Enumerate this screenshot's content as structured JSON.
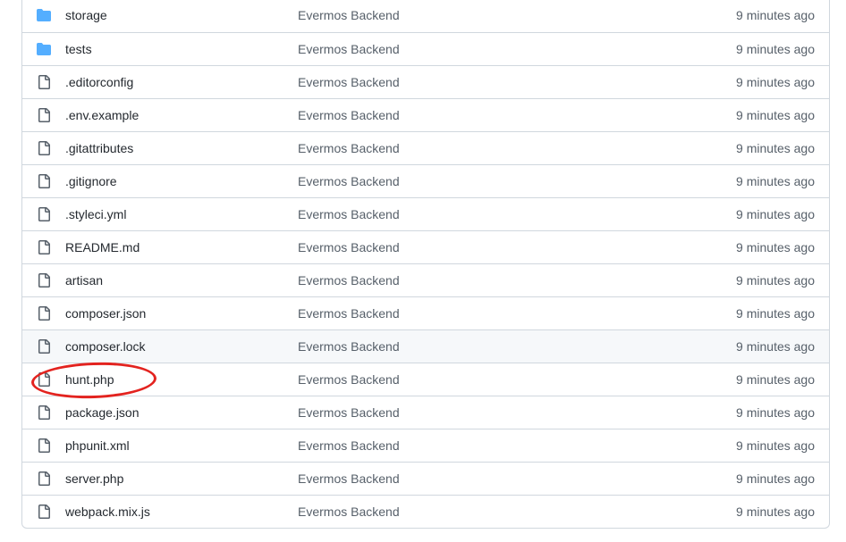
{
  "colors": {
    "folder": "#54aeff",
    "file": "#57606a",
    "annotation": "#e3231f"
  },
  "files": [
    {
      "name": "storage",
      "type": "folder",
      "icon": "folder-icon",
      "commit": "Evermos Backend",
      "age": "9 minutes ago"
    },
    {
      "name": "tests",
      "type": "folder",
      "icon": "folder-icon",
      "commit": "Evermos Backend",
      "age": "9 minutes ago"
    },
    {
      "name": ".editorconfig",
      "type": "file",
      "icon": "file-icon",
      "commit": "Evermos Backend",
      "age": "9 minutes ago"
    },
    {
      "name": ".env.example",
      "type": "file",
      "icon": "file-icon",
      "commit": "Evermos Backend",
      "age": "9 minutes ago"
    },
    {
      "name": ".gitattributes",
      "type": "file",
      "icon": "file-icon",
      "commit": "Evermos Backend",
      "age": "9 minutes ago"
    },
    {
      "name": ".gitignore",
      "type": "file",
      "icon": "file-icon",
      "commit": "Evermos Backend",
      "age": "9 minutes ago"
    },
    {
      "name": ".styleci.yml",
      "type": "file",
      "icon": "file-icon",
      "commit": "Evermos Backend",
      "age": "9 minutes ago"
    },
    {
      "name": "README.md",
      "type": "file",
      "icon": "file-icon",
      "commit": "Evermos Backend",
      "age": "9 minutes ago"
    },
    {
      "name": "artisan",
      "type": "file",
      "icon": "file-icon",
      "commit": "Evermos Backend",
      "age": "9 minutes ago"
    },
    {
      "name": "composer.json",
      "type": "file",
      "icon": "file-icon",
      "commit": "Evermos Backend",
      "age": "9 minutes ago"
    },
    {
      "name": "composer.lock",
      "type": "file",
      "icon": "file-icon",
      "commit": "Evermos Backend",
      "age": "9 minutes ago"
    },
    {
      "name": "hunt.php",
      "type": "file",
      "icon": "file-icon",
      "commit": "Evermos Backend",
      "age": "9 minutes ago"
    },
    {
      "name": "package.json",
      "type": "file",
      "icon": "file-icon",
      "commit": "Evermos Backend",
      "age": "9 minutes ago"
    },
    {
      "name": "phpunit.xml",
      "type": "file",
      "icon": "file-icon",
      "commit": "Evermos Backend",
      "age": "9 minutes ago"
    },
    {
      "name": "server.php",
      "type": "file",
      "icon": "file-icon",
      "commit": "Evermos Backend",
      "age": "9 minutes ago"
    },
    {
      "name": "webpack.mix.js",
      "type": "file",
      "icon": "file-icon",
      "commit": "Evermos Backend",
      "age": "9 minutes ago"
    }
  ]
}
